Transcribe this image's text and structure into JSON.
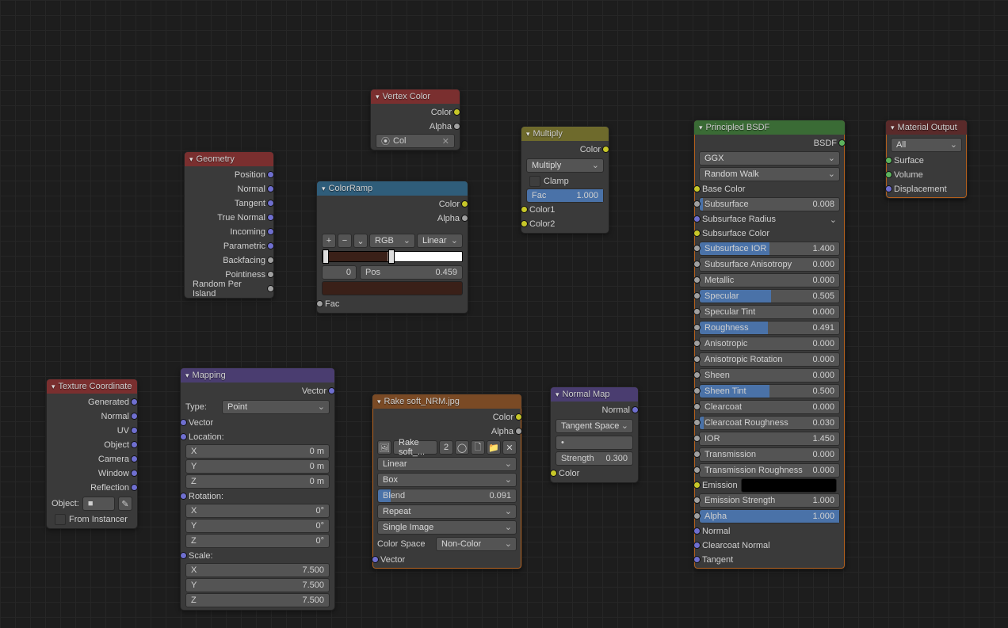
{
  "nodes": {
    "geometry": {
      "title": "Geometry",
      "outs": [
        "Position",
        "Normal",
        "Tangent",
        "True Normal",
        "Incoming",
        "Parametric",
        "Backfacing",
        "Pointiness",
        "Random Per Island"
      ]
    },
    "vertex_color": {
      "title": "Vertex Color",
      "outs": [
        "Color",
        "Alpha"
      ],
      "field_icon": "⦿",
      "field_value": "Col"
    },
    "color_ramp": {
      "title": "ColorRamp",
      "outs": [
        "Color",
        "Alpha"
      ],
      "interp1": "RGB",
      "interp2": "Linear",
      "index": "0",
      "pos_label": "Pos",
      "pos_value": "0.459",
      "fac_label": "Fac"
    },
    "multiply": {
      "title": "Multiply",
      "out": "Color",
      "mode": "Multiply",
      "clamp": "Clamp",
      "fac_label": "Fac",
      "fac_value": "1.000",
      "in1": "Color1",
      "in2": "Color2"
    },
    "principled": {
      "title": "Principled BSDF",
      "out": "BSDF",
      "distribution": "GGX",
      "subsurface_method": "Random Walk",
      "rows": [
        {
          "label": "Base Color",
          "socket": "color"
        },
        {
          "label": "Subsurface",
          "value": "0.008",
          "fill": 0.02
        },
        {
          "label": "Subsurface Radius",
          "socket": "vec",
          "chevron": true
        },
        {
          "label": "Subsurface Color",
          "socket": "color"
        },
        {
          "label": "Subsurface IOR",
          "value": "1.400",
          "fill": 0.5
        },
        {
          "label": "Subsurface Anisotropy",
          "value": "0.000",
          "fill": 0
        },
        {
          "label": "Metallic",
          "value": "0.000",
          "fill": 0
        },
        {
          "label": "Specular",
          "value": "0.505",
          "fill": 0.505
        },
        {
          "label": "Specular Tint",
          "value": "0.000",
          "fill": 0
        },
        {
          "label": "Roughness",
          "value": "0.491",
          "fill": 0.491
        },
        {
          "label": "Anisotropic",
          "value": "0.000",
          "fill": 0
        },
        {
          "label": "Anisotropic Rotation",
          "value": "0.000",
          "fill": 0
        },
        {
          "label": "Sheen",
          "value": "0.000",
          "fill": 0
        },
        {
          "label": "Sheen Tint",
          "value": "0.500",
          "fill": 0.5
        },
        {
          "label": "Clearcoat",
          "value": "0.000",
          "fill": 0
        },
        {
          "label": "Clearcoat Roughness",
          "value": "0.030",
          "fill": 0.03
        },
        {
          "label": "IOR",
          "value": "1.450",
          "text": true
        },
        {
          "label": "Transmission",
          "value": "0.000",
          "fill": 0
        },
        {
          "label": "Transmission Roughness",
          "value": "0.000",
          "fill": 0
        },
        {
          "label": "Emission",
          "socket": "color",
          "swatch": true
        },
        {
          "label": "Emission Strength",
          "value": "1.000",
          "text": true
        },
        {
          "label": "Alpha",
          "value": "1.000",
          "fill": 1.0
        },
        {
          "label": "Normal",
          "socket": "vec",
          "plain": true
        },
        {
          "label": "Clearcoat Normal",
          "socket": "vec",
          "plain": true
        },
        {
          "label": "Tangent",
          "socket": "vec",
          "plain": true
        }
      ]
    },
    "material_output": {
      "title": "Material Output",
      "target": "All",
      "ins": [
        "Surface",
        "Volume",
        "Displacement"
      ]
    },
    "tex_coord": {
      "title": "Texture Coordinate",
      "outs": [
        "Generated",
        "Normal",
        "UV",
        "Object",
        "Camera",
        "Window",
        "Reflection"
      ],
      "object_label": "Object:",
      "from_instancer": "From Instancer"
    },
    "mapping": {
      "title": "Mapping",
      "out": "Vector",
      "type_label": "Type:",
      "type_value": "Point",
      "vector_label": "Vector",
      "loc_label": "Location:",
      "loc": [
        {
          "a": "X",
          "v": "0 m"
        },
        {
          "a": "Y",
          "v": "0 m"
        },
        {
          "a": "Z",
          "v": "0 m"
        }
      ],
      "rot_label": "Rotation:",
      "rot": [
        {
          "a": "X",
          "v": "0°"
        },
        {
          "a": "Y",
          "v": "0°"
        },
        {
          "a": "Z",
          "v": "0°"
        }
      ],
      "scale_label": "Scale:",
      "scale": [
        {
          "a": "X",
          "v": "7.500"
        },
        {
          "a": "Y",
          "v": "7.500"
        },
        {
          "a": "Z",
          "v": "7.500"
        }
      ]
    },
    "image_tex": {
      "title": "Rake soft_NRM.jpg",
      "out1": "Color",
      "out2": "Alpha",
      "image_name": "Rake soft_...",
      "users": "2",
      "interp": "Linear",
      "proj": "Box",
      "blend_label": "Blend",
      "blend_value": "0.091",
      "ext": "Repeat",
      "source": "Single Image",
      "cs_label": "Color Space",
      "cs_value": "Non-Color",
      "vec_label": "Vector"
    },
    "normal_map": {
      "title": "Normal Map",
      "out": "Normal",
      "space": "Tangent Space",
      "uvmap": "",
      "strength_label": "Strength",
      "strength_value": "0.300",
      "color_label": "Color"
    }
  }
}
